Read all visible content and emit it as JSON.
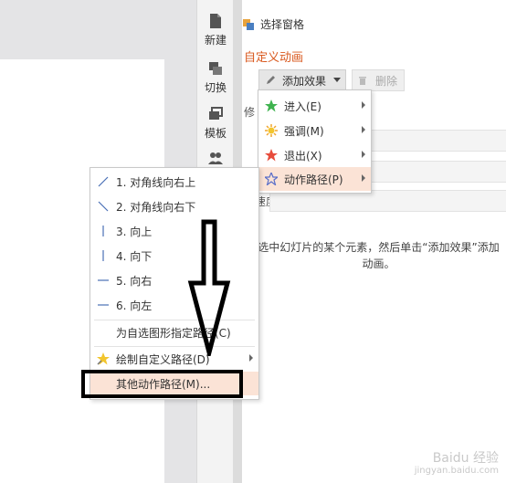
{
  "sidebar": {
    "tools": [
      {
        "label": "新建",
        "icon": "new-doc-icon"
      },
      {
        "label": "切换",
        "icon": "switch-icon"
      },
      {
        "label": "模板",
        "icon": "template-icon"
      },
      {
        "label": "",
        "icon": "users-icon"
      }
    ]
  },
  "pane": {
    "title": "选择窗格",
    "section_title": "自定义动画",
    "add_effect_label": "添加效果",
    "delete_label": "删除",
    "modify_prefix": "修",
    "speed_label": "速度:",
    "hint_text": "选中幻灯片的某个元素，然后单击“添加效果”添加动画。"
  },
  "effect_menu": {
    "items": [
      {
        "label": "进入(E)",
        "icon": "enter-star-icon",
        "color": "#3fb34f",
        "submenu": true
      },
      {
        "label": "强调(M)",
        "icon": "emphasis-star-icon",
        "color": "#f2c52d",
        "submenu": true
      },
      {
        "label": "退出(X)",
        "icon": "exit-star-icon",
        "color": "#e74c3c",
        "submenu": true
      },
      {
        "label": "动作路径(P)",
        "icon": "motion-path-star-icon",
        "color": "#5a6ec8",
        "submenu": true,
        "highlighted": true
      }
    ]
  },
  "path_menu": {
    "items": [
      {
        "label": "1. 对角线向右上",
        "icon": "diag-up-line-icon"
      },
      {
        "label": "2. 对角线向右下",
        "icon": "diag-down-line-icon"
      },
      {
        "label": "3. 向上",
        "icon": "vertical-line-icon"
      },
      {
        "label": "4. 向下",
        "icon": "vertical-line-icon"
      },
      {
        "label": "5. 向右",
        "icon": "horizontal-line-icon"
      },
      {
        "label": "6. 向左",
        "icon": "horizontal-line-icon"
      }
    ],
    "custom_shape_label": "为自选图形指定路径(C)",
    "draw_custom_label": "绘制自定义路径(D)",
    "other_paths_label": "其他动作路径(M)..."
  },
  "watermark": {
    "line1": "Baidu 经验",
    "line2": "jingyan.baidu.com"
  },
  "colors": {
    "accent": "#d9591f",
    "highlight": "#fbe3d6"
  }
}
